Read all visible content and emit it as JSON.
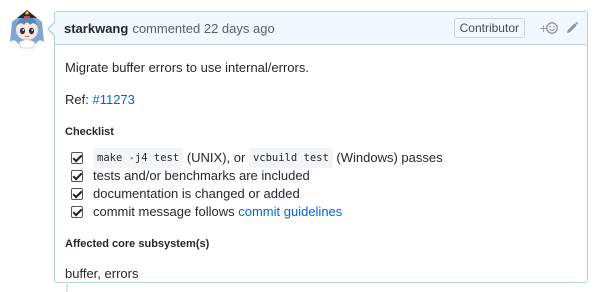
{
  "comment": {
    "author": "starkwang",
    "action": "commented",
    "timestamp": "22 days ago",
    "role_badge": "Contributor",
    "icons": {
      "reaction": "add-reaction-icon",
      "edit": "edit-pencil-icon"
    },
    "summary": "Migrate buffer errors to use internal/errors.",
    "ref_label": "Ref:",
    "ref_link": "#11273",
    "checklist_heading": "Checklist",
    "checklist": [
      {
        "checked": true,
        "code1": "make -j4 test",
        "text1": "(UNIX), or",
        "code2": "vcbuild test",
        "text2": "(Windows) passes"
      },
      {
        "checked": true,
        "text": "tests and/or benchmarks are included"
      },
      {
        "checked": true,
        "text": "documentation is changed or added"
      },
      {
        "checked": true,
        "text": "commit message follows",
        "link": "commit guidelines"
      }
    ],
    "subsystems_heading": "Affected core subsystem(s)",
    "subsystems": "buffer, errors"
  }
}
